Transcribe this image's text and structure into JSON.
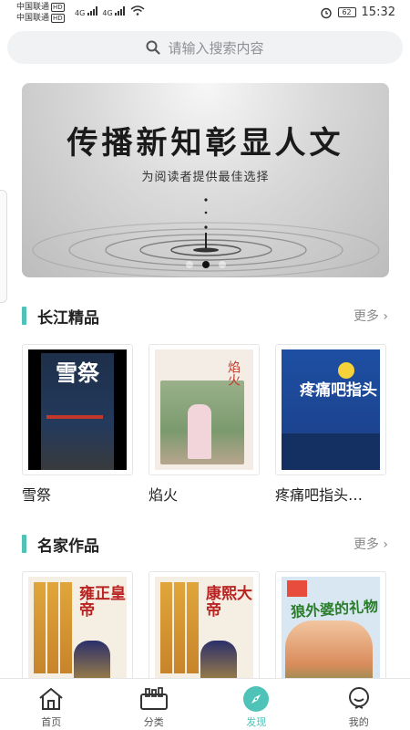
{
  "status_bar": {
    "carrier1": "中国联通",
    "carrier2": "中国联通",
    "hd": "HD",
    "signal": "4G",
    "battery": "62",
    "time": "15:32"
  },
  "search": {
    "placeholder": "请输入搜索内容"
  },
  "banner": {
    "title": "传播新知彰显人文",
    "subtitle": "为阅读者提供最佳选择",
    "slide_count": 3,
    "active_slide": 2
  },
  "sections": [
    {
      "title": "长江精品",
      "more": "更多",
      "books": [
        {
          "name": "雪祭",
          "cover_title": "雪祭"
        },
        {
          "name": "焰火",
          "cover_title": "焰火"
        },
        {
          "name": "疼痛吧指头…",
          "cover_title": "疼痛吧指头"
        }
      ]
    },
    {
      "title": "名家作品",
      "more": "更多",
      "books": [
        {
          "name": "",
          "cover_title": "雍正皇帝"
        },
        {
          "name": "",
          "cover_title": "康熙大帝"
        },
        {
          "name": "",
          "cover_title": "狼外婆的礼物"
        }
      ]
    }
  ],
  "nav": [
    {
      "label": "首页",
      "icon": "home-icon"
    },
    {
      "label": "分类",
      "icon": "category-icon"
    },
    {
      "label": "发现",
      "icon": "compass-icon",
      "active": true
    },
    {
      "label": "我的",
      "icon": "profile-icon"
    }
  ],
  "colors": {
    "accent": "#4fc3b8"
  }
}
